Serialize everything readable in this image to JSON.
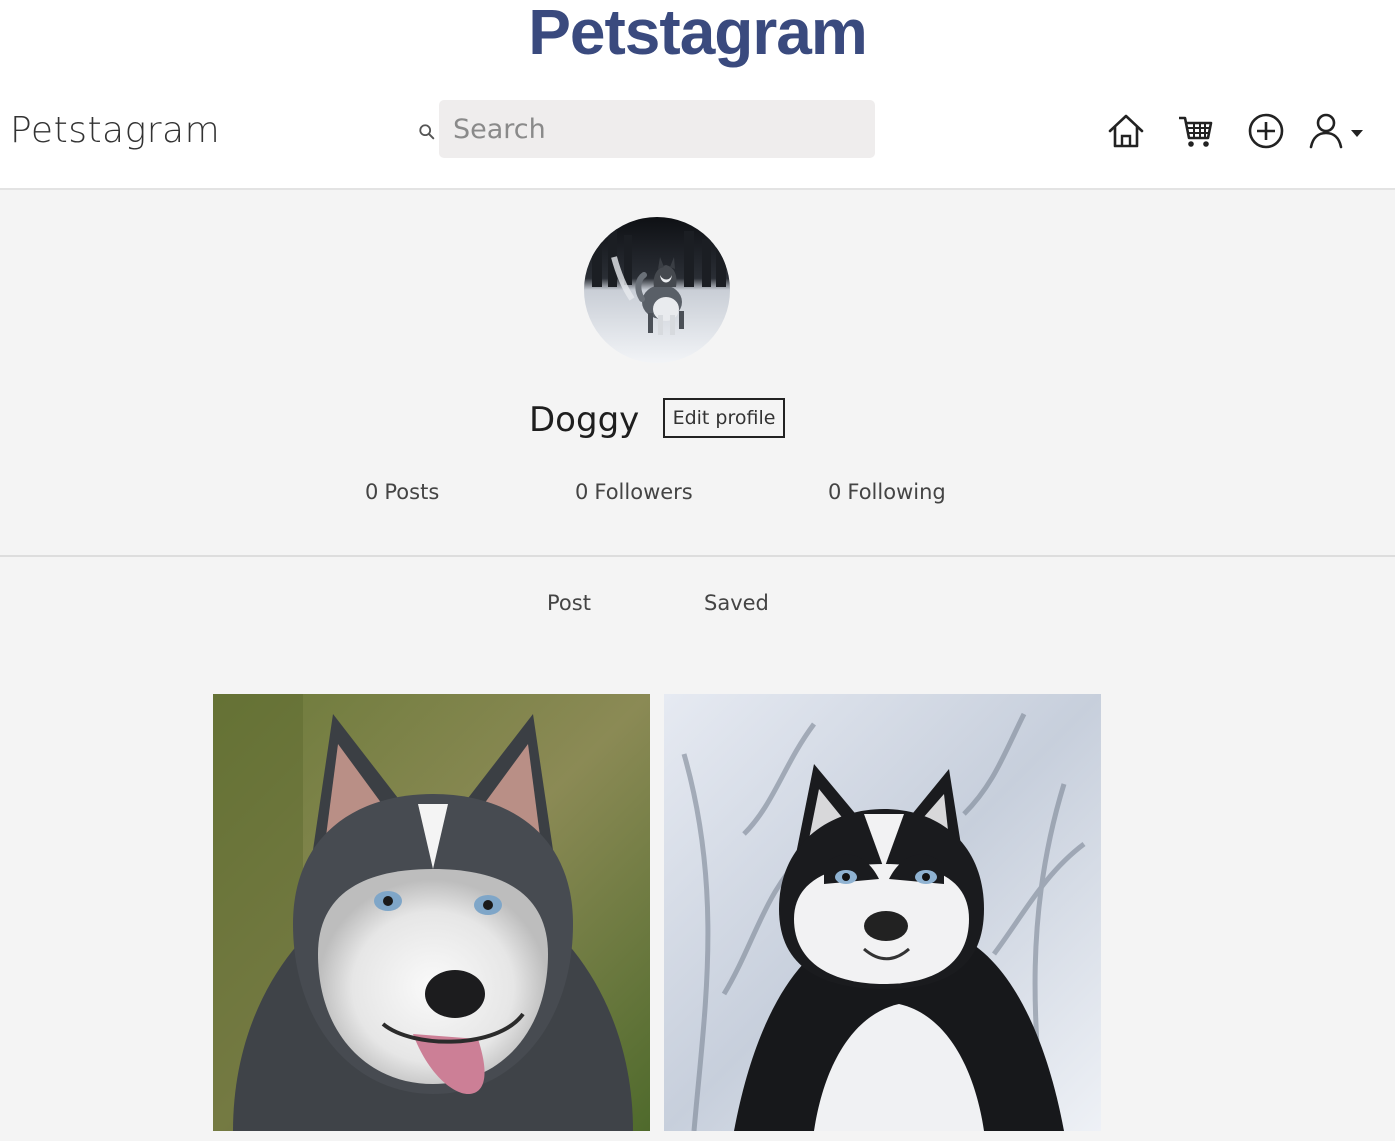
{
  "page": {
    "banner_title": "Petstagram"
  },
  "navbar": {
    "brand": "Petstagram",
    "search": {
      "placeholder": "Search",
      "value": ""
    },
    "icons": [
      "home-icon",
      "cart-icon",
      "add-post-icon",
      "user-icon"
    ]
  },
  "profile": {
    "username": "Doggy",
    "edit_label": "Edit profile",
    "stats": {
      "posts_count": "0",
      "posts_label": "Posts",
      "followers_count": "0",
      "followers_label": "Followers",
      "following_count": "0",
      "following_label": "Following"
    }
  },
  "tabs": {
    "post_label": "Post",
    "saved_label": "Saved"
  },
  "posts": [
    "husky-photo-1",
    "husky-photo-2"
  ],
  "colors": {
    "banner": "#3a4a7e",
    "page_bg": "#f4f4f4",
    "search_bg": "#efeded"
  }
}
